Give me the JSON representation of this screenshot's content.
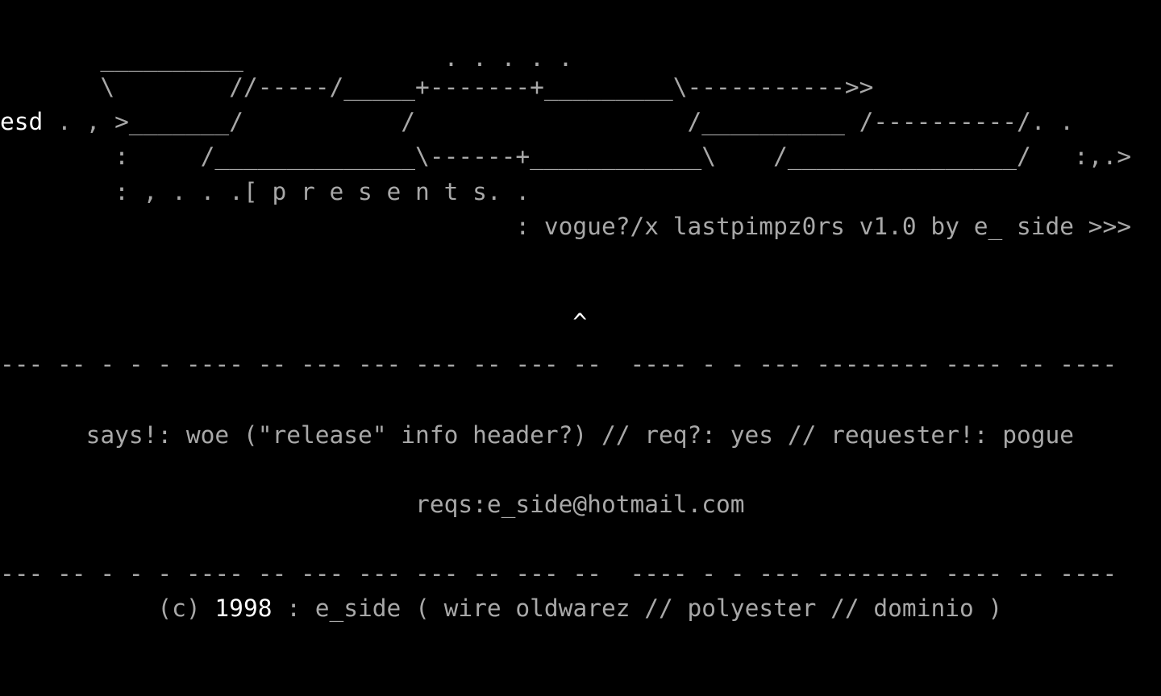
{
  "colors": {
    "background": "#000000",
    "text_dim": "#a8a8a8",
    "text_bright": "#ffffff"
  },
  "art": {
    "line1": "       __________              . . . . .",
    "line2": "       \\        //-----/_____+-------+_________\\----------->>",
    "line3_tag": "esd",
    "line3": " . , >_______/           /                   /__________ /----------/. .",
    "line4": "        :     /______________\\------+____________\\    /________________/   :,.>",
    "line5": "        : , . . .[ p r e s e n t s. ."
  },
  "release_title": "                                    : vogue?/x lastpimpz0rs v1.0 by e_ side >>>",
  "cursor_caret": "                                        ^",
  "divider": "--- -- - - - ---- -- --- --- --- -- --- --  ---- - - --- -------- ---- -- ----",
  "info_line": "      says!: woe (\"release\" info header?) // req?: yes // requester!: pogue",
  "requests_line": "                             reqs:e_side@hotmail.com",
  "footer": {
    "prefix": "           (c) ",
    "year": "1998",
    "suffix": " : e_side ( wire oldwarez // polyester // dominio )"
  }
}
